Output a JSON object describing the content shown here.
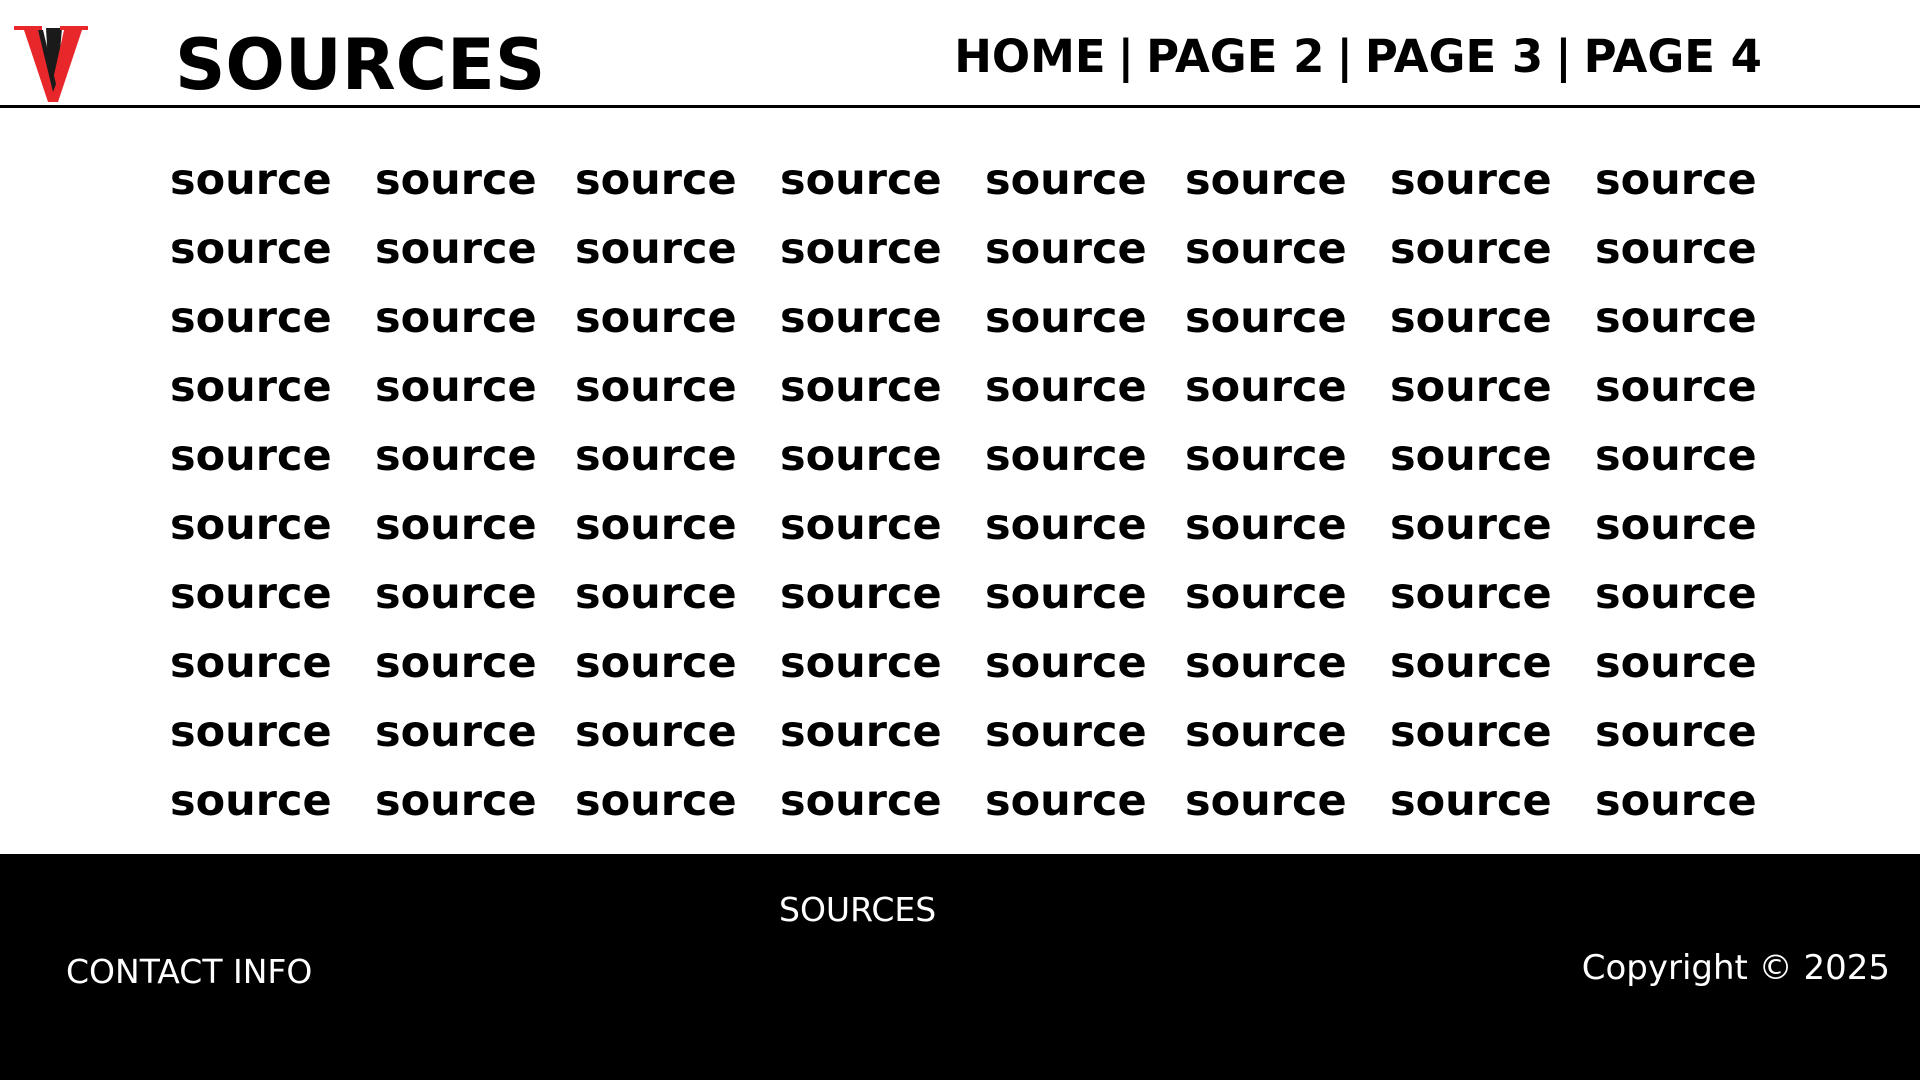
{
  "header": {
    "logo_icon": "v-logo-icon",
    "logo_colors": {
      "primary": "#e8272a",
      "shadow": "#1a1a1a"
    },
    "title": "SOURCES",
    "nav": [
      {
        "label": "HOME"
      },
      {
        "label": "PAGE 2"
      },
      {
        "label": "PAGE 3"
      },
      {
        "label": "PAGE 4"
      }
    ],
    "nav_separator": "|"
  },
  "grid": {
    "rows": [
      [
        "source",
        "source",
        "source",
        "source",
        "source",
        "source",
        "source",
        "source"
      ],
      [
        "source",
        "source",
        "source",
        "source",
        "source",
        "source",
        "source",
        "source"
      ],
      [
        "source",
        "source",
        "source",
        "source",
        "source",
        "source",
        "source",
        "source"
      ],
      [
        "source",
        "source",
        "source",
        "source",
        "source",
        "source",
        "source",
        "source"
      ],
      [
        "source",
        "source",
        "source",
        "source",
        "source",
        "source",
        "source",
        "source"
      ],
      [
        "source",
        "source",
        "source",
        "source",
        "source",
        "source",
        "source",
        "source"
      ],
      [
        "source",
        "source",
        "source",
        "source",
        "source",
        "source",
        "source",
        "source"
      ],
      [
        "source",
        "source",
        "source",
        "source",
        "source",
        "source",
        "source",
        "source"
      ],
      [
        "source",
        "source",
        "source",
        "source",
        "source",
        "source",
        "source",
        "source"
      ],
      [
        "source",
        "source",
        "source",
        "source",
        "source",
        "source",
        "source",
        "source"
      ]
    ]
  },
  "footer": {
    "title": "SOURCES",
    "contact": "CONTACT INFO",
    "copyright": "Copyright © 2025",
    "background": "#000000",
    "text_color": "#ffffff"
  }
}
